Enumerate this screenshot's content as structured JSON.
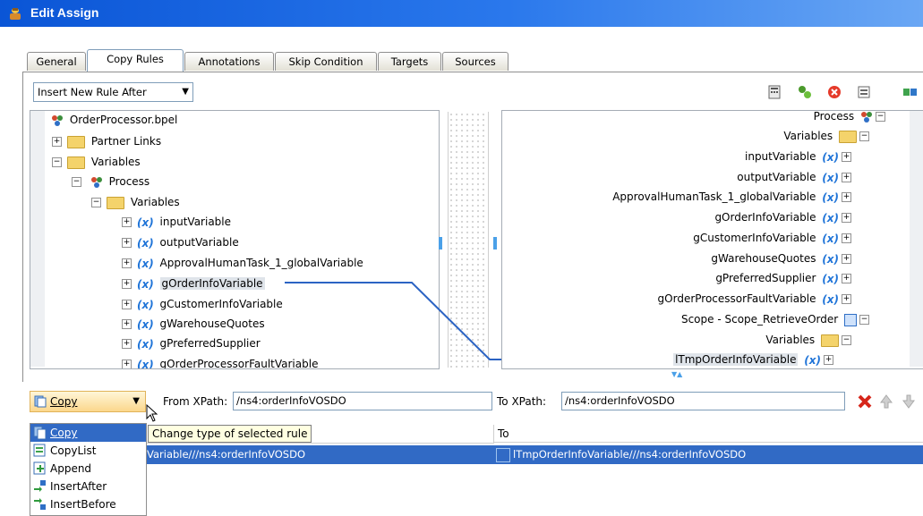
{
  "window": {
    "title": "Edit Assign"
  },
  "tabs": [
    {
      "label": "General"
    },
    {
      "label": "Copy Rules"
    },
    {
      "label": "Annotations"
    },
    {
      "label": "Skip Condition"
    },
    {
      "label": "Targets"
    },
    {
      "label": "Sources"
    }
  ],
  "insert_rule": {
    "value": "Insert New Rule After"
  },
  "source_tree": {
    "root": "OrderProcessor.bpel",
    "partner_links": "Partner Links",
    "variables": "Variables",
    "process": "Process",
    "process_variables": "Variables",
    "items": [
      "inputVariable",
      "outputVariable",
      "ApprovalHumanTask_1_globalVariable",
      "gOrderInfoVariable",
      "gCustomerInfoVariable",
      "gWarehouseQuotes",
      "gPreferredSupplier",
      "gOrderProcessorFaultVariable"
    ]
  },
  "target_tree": {
    "process": "Process",
    "variables": "Variables",
    "items": [
      "inputVariable",
      "outputVariable",
      "ApprovalHumanTask_1_globalVariable",
      "gOrderInfoVariable",
      "gCustomerInfoVariable",
      "gWarehouseQuotes",
      "gPreferredSupplier",
      "gOrderProcessorFaultVariable"
    ],
    "scope": "Scope - Scope_RetrieveOrder",
    "scope_variables": "Variables",
    "scope_item": "lTmpOrderInfoVariable"
  },
  "rule_bar": {
    "copy_value": "Copy",
    "from_label": "From XPath:",
    "from_value": "/ns4:orderInfoVOSDO",
    "to_label": "To XPath:",
    "to_value": "/ns4:orderInfoVOSDO"
  },
  "menu": {
    "items": [
      "Copy",
      "CopyList",
      "Append",
      "InsertAfter",
      "InsertBefore"
    ]
  },
  "tooltip": "Change type of selected rule",
  "grid": {
    "to_header": "To",
    "row_from": "Variable///ns4:orderInfoVOSDO",
    "row_to": "lTmpOrderInfoVariable///ns4:orderInfoVOSDO"
  }
}
